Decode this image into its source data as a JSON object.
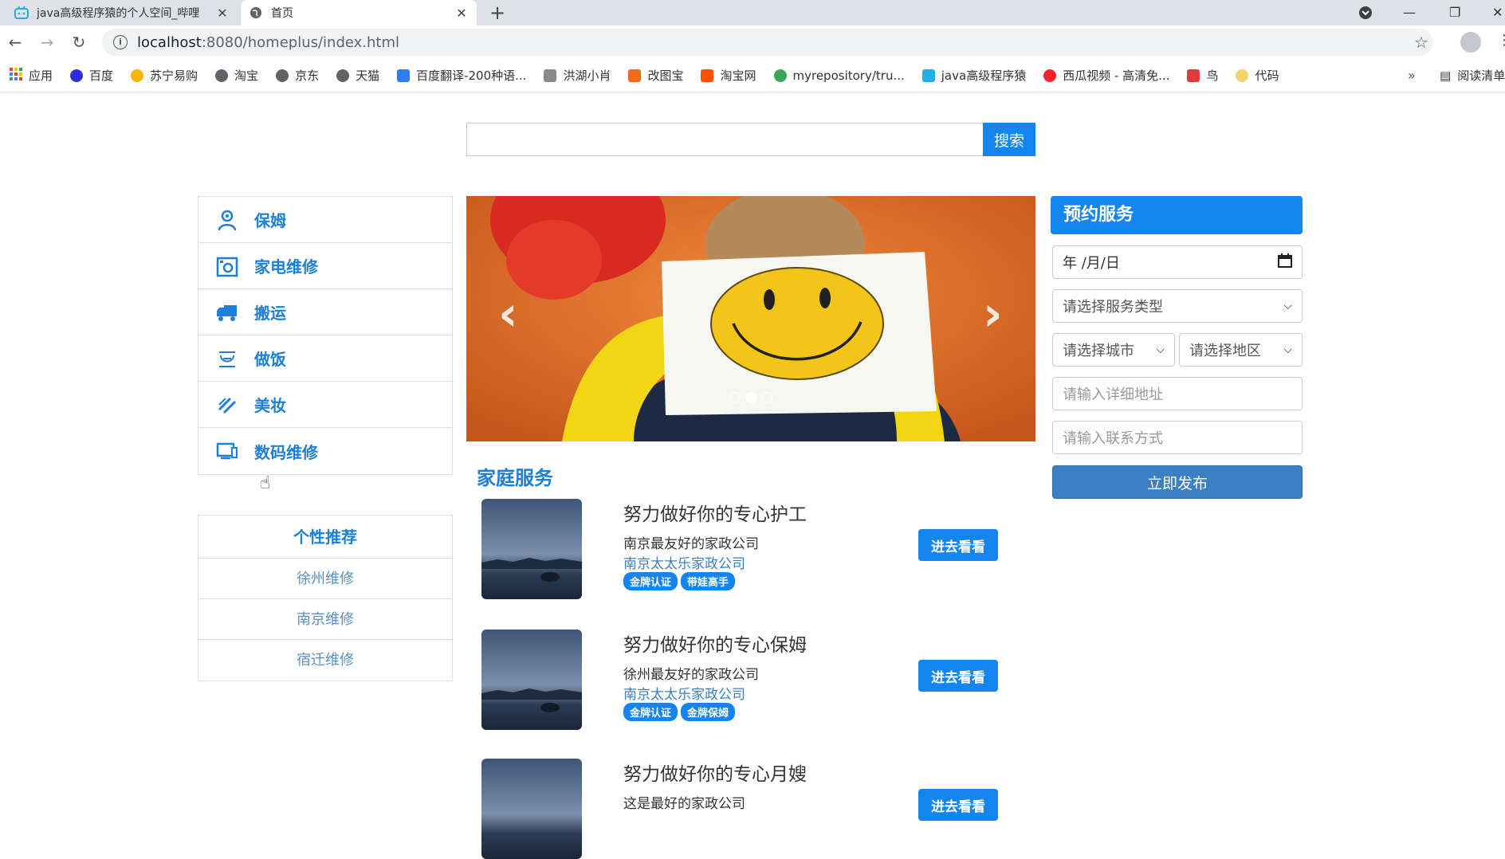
{
  "browser": {
    "tabs": [
      {
        "title": "java高级程序猿的个人空间_哔哩",
        "close": "✕"
      },
      {
        "title": "首页",
        "close": "✕"
      }
    ],
    "new_tab": "+",
    "url_host": "localhost",
    "url_path": ":8080/homeplus/index.html",
    "bookmarks": [
      {
        "label": "应用",
        "color": "#e94235"
      },
      {
        "label": "百度",
        "color": "#2932e1"
      },
      {
        "label": "苏宁易购",
        "color": "#f5b50a"
      },
      {
        "label": "淘宝",
        "color": "#555555"
      },
      {
        "label": "京东",
        "color": "#555555"
      },
      {
        "label": "天猫",
        "color": "#555555"
      },
      {
        "label": "百度翻译-200种语...",
        "color": "#2b7ff0"
      },
      {
        "label": "洪湖小肖",
        "color": "#8a8a8a"
      },
      {
        "label": "改图宝",
        "color": "#f06a1d"
      },
      {
        "label": "淘宝网",
        "color": "#ff5000"
      },
      {
        "label": "myrepository/tru...",
        "color": "#3aa757"
      },
      {
        "label": "java高级程序猿",
        "color": "#23ade5"
      },
      {
        "label": "西瓜视频 - 高清免...",
        "color": "#f5222d"
      },
      {
        "label": "鸟",
        "color": "#e23b3b"
      },
      {
        "label": "代码",
        "color": "#f3d36b"
      }
    ],
    "bookmarks_more": "»",
    "reading_list": "阅读清单"
  },
  "search": {
    "placeholder": "",
    "button": "搜索"
  },
  "categories": [
    {
      "label": "保姆",
      "icon": "nanny-icon"
    },
    {
      "label": "家电维修",
      "icon": "appliance-repair-icon"
    },
    {
      "label": "搬运",
      "icon": "truck-icon"
    },
    {
      "label": "做饭",
      "icon": "cooking-icon"
    },
    {
      "label": "美妆",
      "icon": "makeup-icon"
    },
    {
      "label": "数码维修",
      "icon": "digital-repair-icon"
    }
  ],
  "recommend": {
    "title": "个性推荐",
    "items": [
      "徐州维修",
      "南京维修",
      "宿迁维修"
    ]
  },
  "carousel": {
    "prev": "‹",
    "next": "›",
    "active_index": 1,
    "count": 3
  },
  "services": {
    "title": "家庭服务",
    "items": [
      {
        "title": "努力做好你的专心护工",
        "line1": "南京最友好的家政公司",
        "line2": "南京太太乐家政公司",
        "badges": [
          "金牌认证",
          "带娃高手"
        ],
        "button": "进去看看"
      },
      {
        "title": "努力做好你的专心保姆",
        "line1": "徐州最友好的家政公司",
        "line2": "南京太太乐家政公司",
        "badges": [
          "金牌认证",
          "金牌保姆"
        ],
        "button": "进去看看"
      },
      {
        "title": "努力做好你的专心月嫂",
        "line1": "这是最好的家政公司",
        "line2": "",
        "badges": [],
        "button": "进去看看"
      }
    ]
  },
  "booking": {
    "title": "预约服务",
    "date": "年 /月/日",
    "service_type": "请选择服务类型",
    "city": "请选择城市",
    "district": "请选择地区",
    "address_placeholder": "请输入详细地址",
    "contact_placeholder": "请输入联系方式",
    "submit": "立即发布"
  },
  "colors": {
    "accent": "#1485ee",
    "link": "#1e7fd6",
    "submit": "#3b80c5"
  }
}
